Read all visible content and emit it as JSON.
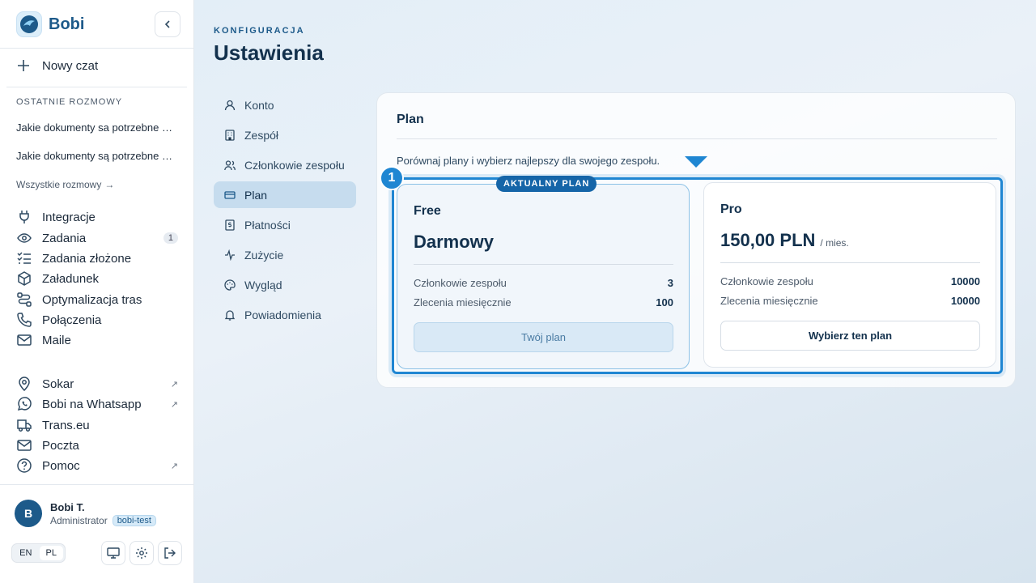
{
  "sidebar": {
    "brand": "Bobi",
    "new_chat": "Nowy czat",
    "recent_label": "OSTATNIE ROZMOWY",
    "recent": [
      "Jakie dokumenty sa potrzebne do przewozu?",
      "Jakie dokumenty są potrzebne do przewozu?"
    ],
    "all_chats": "Wszystkie rozmowy",
    "nav": [
      {
        "label": "Integracje",
        "icon": "plug-icon"
      },
      {
        "label": "Zadania",
        "icon": "eye-icon",
        "badge": "1"
      },
      {
        "label": "Zadania złożone",
        "icon": "checklist-icon"
      },
      {
        "label": "Załadunek",
        "icon": "box-icon"
      },
      {
        "label": "Optymalizacja tras",
        "icon": "route-icon"
      },
      {
        "label": "Połączenia",
        "icon": "phone-icon"
      },
      {
        "label": "Maile",
        "icon": "mail-icon"
      }
    ],
    "external": [
      {
        "label": "Sokar",
        "icon": "location-icon",
        "external": true
      },
      {
        "label": "Bobi na Whatsapp",
        "icon": "whatsapp-icon",
        "external": true
      },
      {
        "label": "Trans.eu",
        "icon": "truck-icon",
        "external": false
      },
      {
        "label": "Poczta",
        "icon": "mail-icon",
        "external": false
      },
      {
        "label": "Pomoc",
        "icon": "help-icon",
        "external": true
      }
    ],
    "user": {
      "initial": "B",
      "name": "Bobi T.",
      "role": "Administrator",
      "tenant": "bobi-test"
    },
    "lang": [
      "EN",
      "PL"
    ],
    "lang_active": "PL"
  },
  "header": {
    "eyebrow": "KONFIGURACJA",
    "title": "Ustawienia"
  },
  "settings_nav": [
    {
      "label": "Konto",
      "icon": "user-icon"
    },
    {
      "label": "Zespół",
      "icon": "building-icon"
    },
    {
      "label": "Członkowie zespołu",
      "icon": "users-icon"
    },
    {
      "label": "Plan",
      "icon": "credit-card-icon",
      "active": true
    },
    {
      "label": "Płatności",
      "icon": "receipt-icon"
    },
    {
      "label": "Zużycie",
      "icon": "activity-icon"
    },
    {
      "label": "Wygląd",
      "icon": "palette-icon"
    },
    {
      "label": "Powiadomienia",
      "icon": "bell-icon"
    }
  ],
  "plan_panel": {
    "title": "Plan",
    "description": "Porównaj plany i wybierz najlepszy dla swojego zespołu.",
    "marker": "1",
    "current_tag": "AKTUALNY PLAN",
    "plans": [
      {
        "name": "Free",
        "price": "Darmowy",
        "period": "",
        "rows": [
          {
            "label": "Członkowie zespołu",
            "value": "3"
          },
          {
            "label": "Zlecenia miesięcznie",
            "value": "100"
          }
        ],
        "button": "Twój plan",
        "current": true
      },
      {
        "name": "Pro",
        "price": "150,00 PLN",
        "period": "/ mies.",
        "rows": [
          {
            "label": "Członkowie zespołu",
            "value": "10000"
          },
          {
            "label": "Zlecenia miesięcznie",
            "value": "10000"
          }
        ],
        "button": "Wybierz ten plan",
        "current": false
      }
    ]
  },
  "colors": {
    "accent": "#1f86d2",
    "brand": "#1d5a8a",
    "tag": "#1565a8"
  }
}
